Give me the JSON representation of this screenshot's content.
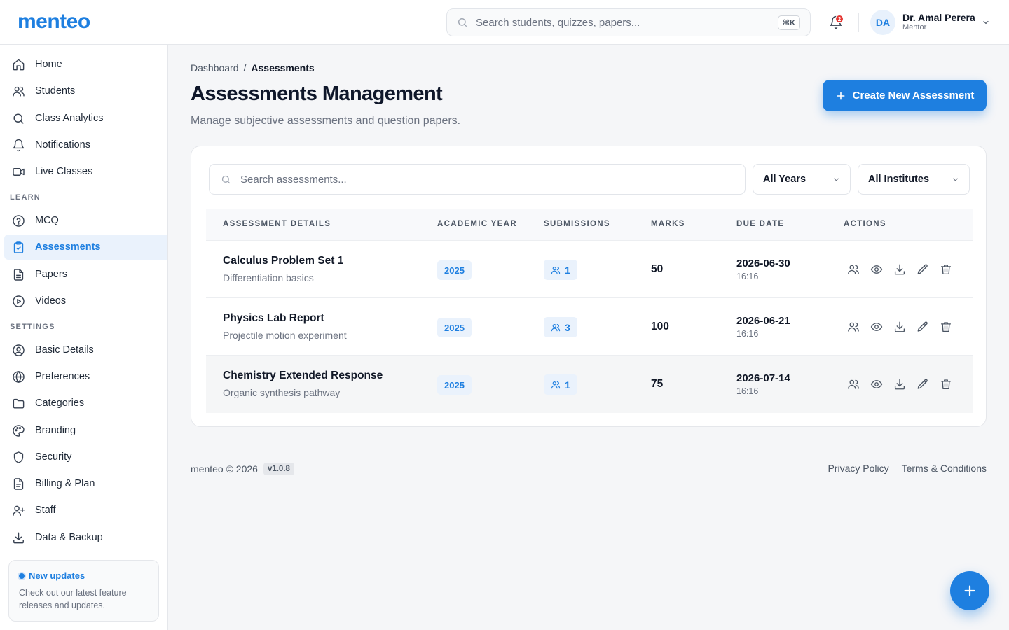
{
  "app": {
    "logo": "menteo"
  },
  "header": {
    "search_placeholder": "Search students, quizzes, papers...",
    "search_shortcut": "⌘K",
    "notification_count": "2",
    "user": {
      "initials": "DA",
      "name": "Dr. Amal Perera",
      "role": "Mentor"
    }
  },
  "sidebar": {
    "main_items": [
      {
        "label": "Home",
        "icon": "home-icon"
      },
      {
        "label": "Students",
        "icon": "users-icon"
      },
      {
        "label": "Class Analytics",
        "icon": "search-icon"
      },
      {
        "label": "Notifications",
        "icon": "bell-icon"
      },
      {
        "label": "Live Classes",
        "icon": "video-icon"
      }
    ],
    "learn_heading": "LEARN",
    "learn_items": [
      {
        "label": "MCQ",
        "icon": "help-circle-icon"
      },
      {
        "label": "Assessments",
        "icon": "clipboard-check-icon",
        "active": true
      },
      {
        "label": "Papers",
        "icon": "file-text-icon"
      },
      {
        "label": "Videos",
        "icon": "play-circle-icon"
      }
    ],
    "settings_heading": "SETTINGS",
    "settings_items": [
      {
        "label": "Basic Details",
        "icon": "user-circle-icon"
      },
      {
        "label": "Preferences",
        "icon": "globe-icon"
      },
      {
        "label": "Categories",
        "icon": "folder-icon"
      },
      {
        "label": "Branding",
        "icon": "palette-icon"
      },
      {
        "label": "Security",
        "icon": "shield-icon"
      },
      {
        "label": "Billing & Plan",
        "icon": "file-invoice-icon"
      },
      {
        "label": "Staff",
        "icon": "user-plus-icon"
      },
      {
        "label": "Data & Backup",
        "icon": "download-icon"
      }
    ],
    "updates": {
      "title": "New updates",
      "text": "Check out our latest feature releases and updates."
    }
  },
  "main": {
    "breadcrumb": {
      "parent": "Dashboard",
      "separator": "/",
      "current": "Assessments"
    },
    "title": "Assessments Management",
    "subtitle": "Manage subjective assessments and question papers.",
    "create_button": "Create New Assessment",
    "filters": {
      "search_placeholder": "Search assessments...",
      "year_select": "All Years",
      "institute_select": "All Institutes"
    },
    "table": {
      "columns": [
        "ASSESSMENT DETAILS",
        "ACADEMIC YEAR",
        "SUBMISSIONS",
        "MARKS",
        "DUE DATE",
        "ACTIONS"
      ],
      "rows": [
        {
          "title": "Calculus Problem Set 1",
          "subtitle": "Differentiation basics",
          "year": "2025",
          "submissions": "1",
          "marks": "50",
          "due_date": "2026-06-30",
          "due_time": "16:16"
        },
        {
          "title": "Physics Lab Report",
          "subtitle": "Projectile motion experiment",
          "year": "2025",
          "submissions": "3",
          "marks": "100",
          "due_date": "2026-06-21",
          "due_time": "16:16"
        },
        {
          "title": "Chemistry Extended Response",
          "subtitle": "Organic synthesis pathway",
          "year": "2025",
          "submissions": "1",
          "marks": "75",
          "due_date": "2026-07-14",
          "due_time": "16:16"
        }
      ]
    }
  },
  "footer": {
    "copyright": "menteo © 2026",
    "version": "v1.0.8",
    "links": [
      "Privacy Policy",
      "Terms & Conditions"
    ]
  },
  "colors": {
    "accent": "#1e7fe0",
    "accent_soft": "#eaf2fc",
    "danger": "#e53935"
  }
}
